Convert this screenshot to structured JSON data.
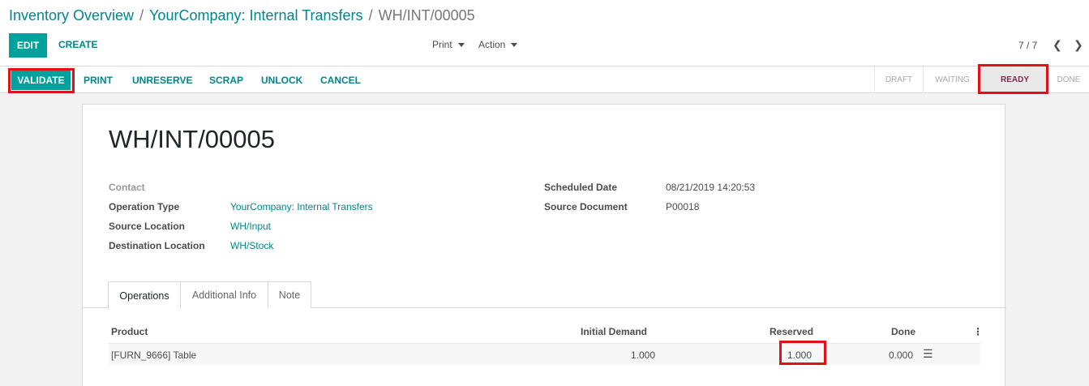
{
  "breadcrumb": {
    "items": [
      "Inventory Overview",
      "YourCompany: Internal Transfers"
    ],
    "separator": "/",
    "current": "WH/INT/00005"
  },
  "toolbar": {
    "edit_label": "EDIT",
    "create_label": "CREATE",
    "print_label": "Print",
    "action_label": "Action",
    "pager": "7 / 7"
  },
  "statusbar": {
    "buttons": [
      "VALIDATE",
      "PRINT",
      "UNRESERVE",
      "SCRAP",
      "UNLOCK",
      "CANCEL"
    ],
    "stages": [
      "DRAFT",
      "WAITING",
      "READY",
      "DONE"
    ],
    "active_stage": "READY"
  },
  "record": {
    "title": "WH/INT/00005",
    "contact_label": "Contact",
    "operation_type_label": "Operation Type",
    "operation_type_value": "YourCompany: Internal Transfers",
    "source_location_label": "Source Location",
    "source_location_value": "WH/Input",
    "destination_location_label": "Destination Location",
    "destination_location_value": "WH/Stock",
    "scheduled_date_label": "Scheduled Date",
    "scheduled_date_value": "08/21/2019 14:20:53",
    "source_document_label": "Source Document",
    "source_document_value": "P00018"
  },
  "tabs": [
    "Operations",
    "Additional Info",
    "Note"
  ],
  "operations": {
    "headers": {
      "product": "Product",
      "initial_demand": "Initial Demand",
      "reserved": "Reserved",
      "done": "Done"
    },
    "rows": [
      {
        "product": "[FURN_9666] Table",
        "initial_demand": "1.000",
        "reserved": "1.000",
        "done": "0.000"
      }
    ]
  },
  "colors": {
    "primary": "#00a09d",
    "link": "#00868b",
    "highlight": "#e3101a",
    "active_stage_text": "#7c2b4d"
  }
}
